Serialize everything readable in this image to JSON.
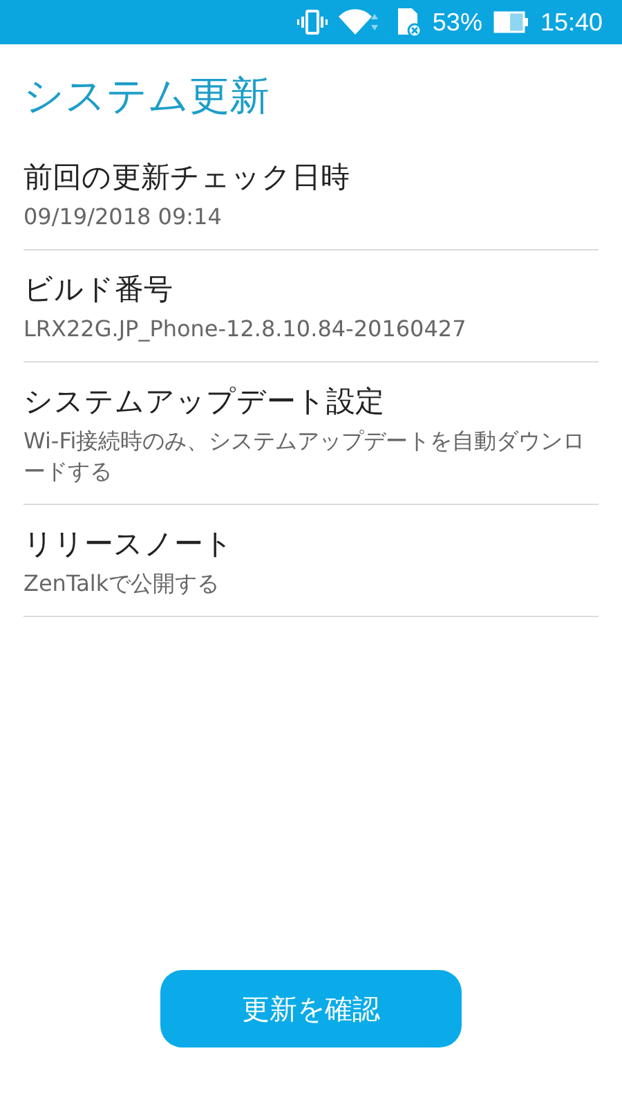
{
  "status_bar": {
    "battery_percent": "53%",
    "time": "15:40"
  },
  "title": "システム更新",
  "items": [
    {
      "title": "前回の更新チェック日時",
      "subtitle": "09/19/2018 09:14"
    },
    {
      "title": "ビルド番号",
      "subtitle": "LRX22G.JP_Phone-12.8.10.84-20160427"
    },
    {
      "title": "システムアップデート設定",
      "subtitle": "Wi-Fi接続時のみ、システムアップデートを自動ダウンロードする"
    },
    {
      "title": "リリースノート",
      "subtitle": "ZenTalkで公開する"
    }
  ],
  "button": "更新を確認"
}
